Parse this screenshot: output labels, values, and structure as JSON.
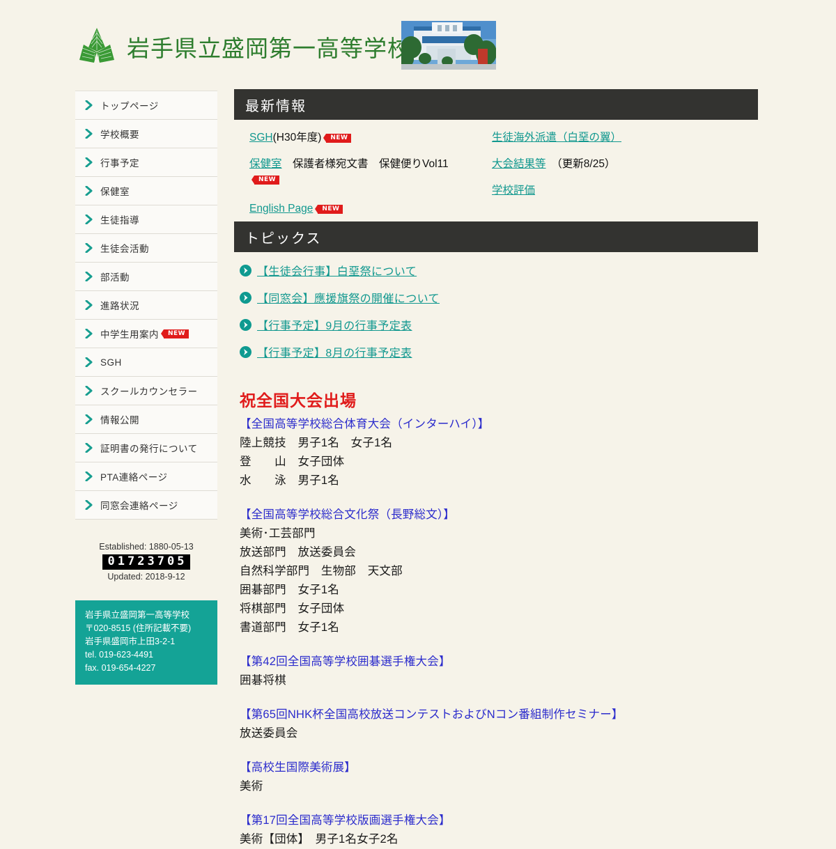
{
  "header": {
    "school_name": "岩手県立盛岡第一高等学校",
    "logo_icon": "green-leaf-emblem-icon",
    "photo_alt": "school-building-photo",
    "title_color": "#2e7d2e"
  },
  "sidebar": {
    "items": [
      {
        "label": "トップページ",
        "badge": ""
      },
      {
        "label": "学校概要",
        "badge": ""
      },
      {
        "label": "行事予定",
        "badge": ""
      },
      {
        "label": "保健室",
        "badge": ""
      },
      {
        "label": "生徒指導",
        "badge": ""
      },
      {
        "label": "生徒会活動",
        "badge": ""
      },
      {
        "label": "部活動",
        "badge": ""
      },
      {
        "label": "進路状況",
        "badge": ""
      },
      {
        "label": "中学生用案内",
        "badge": "NEW"
      },
      {
        "label": "SGH",
        "badge": ""
      },
      {
        "label": "スクールカウンセラー",
        "badge": ""
      },
      {
        "label": "情報公開",
        "badge": ""
      },
      {
        "label": "証明書の発行について",
        "badge": ""
      },
      {
        "label": "PTA連絡ページ",
        "badge": ""
      },
      {
        "label": "同窓会連絡ページ",
        "badge": ""
      }
    ]
  },
  "counter": {
    "established_label": "Established: 1880-05-13",
    "digits": "01723705",
    "updated_label": "Updated: 2018-9-12"
  },
  "contact": {
    "background": "#14a396",
    "lines": [
      "岩手県立盛岡第一高等学校",
      "〒020-8515 (住所記載不要)",
      "岩手県盛岡市上田3-2-1",
      "tel. 019-623-4491",
      "fax. 019-654-4227"
    ]
  },
  "news": {
    "section_title": "最新情報",
    "badge_text": "NEW",
    "left": [
      {
        "link": "SGH",
        "after": "(H30年度)",
        "badge": "NEW",
        "badge_below": false
      },
      {
        "link": "保健室",
        "after": "　保護者様宛文書　保健便りVol11",
        "badge": "NEW",
        "badge_below": true
      },
      {
        "link": "English Page",
        "after": "",
        "badge": "NEW",
        "badge_below": false
      }
    ],
    "right": [
      {
        "link": "生徒海外派遣（白堊の翼）",
        "after": "",
        "badge": "",
        "badge_below": false
      },
      {
        "link": "大会結果等",
        "after": "　（更新8/25）",
        "badge": "",
        "badge_below": false
      },
      {
        "link": "学校評価",
        "after": "",
        "badge": "",
        "badge_below": false
      }
    ]
  },
  "topics": {
    "section_title": "トピックス",
    "bullet_icon": "circle-arrow-right-icon",
    "items": [
      "【生徒会行事】白堊祭について",
      "【同窓会】應援旗祭の開催について",
      "【行事予定】9月の行事予定表",
      "【行事予定】8月の行事予定表"
    ]
  },
  "results": {
    "title": "祝全国大会出場",
    "title_color": "#e01b1b",
    "head_color": "#2b2bcc",
    "groups": [
      {
        "head": "【全国高等学校総合体育大会（インターハイ）】",
        "lines": [
          "陸上競技　男子1名　女子1名",
          "登　　山　女子団体",
          "水　　泳　男子1名"
        ],
        "gap_after": true
      },
      {
        "head": "【全国高等学校総合文化祭（長野総文）】",
        "lines": [
          "美術･工芸部門",
          "放送部門　放送委員会",
          "自然科学部門　生物部　天文部",
          "囲碁部門　女子1名",
          "将棋部門　女子団体",
          "書道部門　女子1名"
        ],
        "gap_after": true
      },
      {
        "head": "【第42回全国高等学校囲碁選手権大会】",
        "lines": [
          "囲碁将棋"
        ],
        "gap_after": true
      },
      {
        "head": "【第65回NHK杯全国高校放送コンテストおよびNコン番組制作セミナー】",
        "lines": [
          "放送委員会"
        ],
        "gap_after": true
      },
      {
        "head": "【高校生国際美術展】",
        "lines": [
          "美術"
        ],
        "gap_after": true
      },
      {
        "head": "【第17回全国高等学校版画選手権大会】",
        "lines": [
          "美術【団体】　男子1名女子2名"
        ],
        "gap_after": false
      }
    ]
  }
}
